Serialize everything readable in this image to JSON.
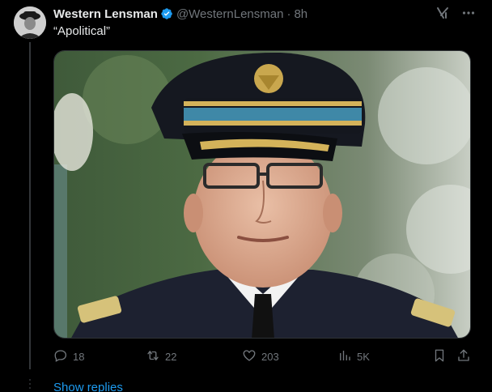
{
  "author": {
    "name": "Western Lensman",
    "handle": "@WesternLensman",
    "separator": "·",
    "time": "8h"
  },
  "tweet": {
    "text": "“Apolitical”"
  },
  "actions": {
    "replies": "18",
    "reposts": "22",
    "likes": "203",
    "views": "5K"
  },
  "show_replies": "Show replies",
  "colors": {
    "background": "#000000",
    "text": "#e7e9ea",
    "muted": "#71767b",
    "accent": "#1d9bf0",
    "border": "#2f3336"
  },
  "icons": [
    "verified-badge-icon",
    "grok-icon",
    "more-icon",
    "reply-icon",
    "repost-icon",
    "like-icon",
    "views-icon",
    "bookmark-icon",
    "share-icon"
  ]
}
